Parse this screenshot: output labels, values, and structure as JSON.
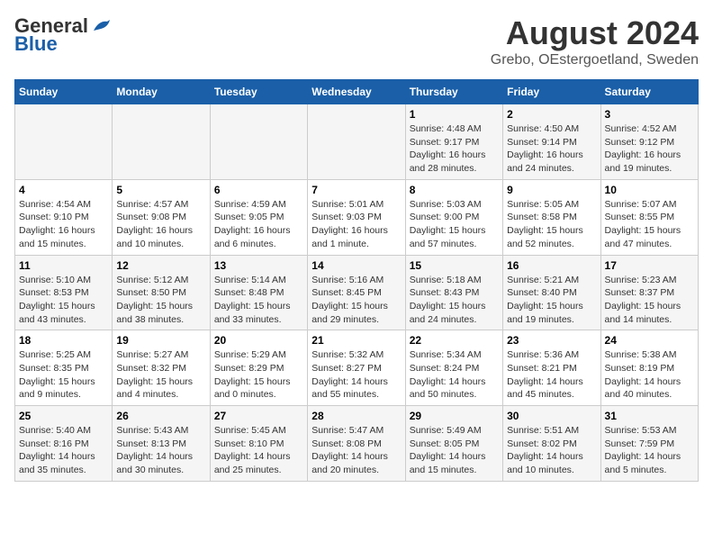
{
  "header": {
    "logo_general": "General",
    "logo_blue": "Blue",
    "main_title": "August 2024",
    "subtitle": "Grebo, OEstergoetland, Sweden"
  },
  "calendar": {
    "days_of_week": [
      "Sunday",
      "Monday",
      "Tuesday",
      "Wednesday",
      "Thursday",
      "Friday",
      "Saturday"
    ],
    "weeks": [
      [
        {
          "day": "",
          "info": ""
        },
        {
          "day": "",
          "info": ""
        },
        {
          "day": "",
          "info": ""
        },
        {
          "day": "",
          "info": ""
        },
        {
          "day": "1",
          "info": "Sunrise: 4:48 AM\nSunset: 9:17 PM\nDaylight: 16 hours\nand 28 minutes."
        },
        {
          "day": "2",
          "info": "Sunrise: 4:50 AM\nSunset: 9:14 PM\nDaylight: 16 hours\nand 24 minutes."
        },
        {
          "day": "3",
          "info": "Sunrise: 4:52 AM\nSunset: 9:12 PM\nDaylight: 16 hours\nand 19 minutes."
        }
      ],
      [
        {
          "day": "4",
          "info": "Sunrise: 4:54 AM\nSunset: 9:10 PM\nDaylight: 16 hours\nand 15 minutes."
        },
        {
          "day": "5",
          "info": "Sunrise: 4:57 AM\nSunset: 9:08 PM\nDaylight: 16 hours\nand 10 minutes."
        },
        {
          "day": "6",
          "info": "Sunrise: 4:59 AM\nSunset: 9:05 PM\nDaylight: 16 hours\nand 6 minutes."
        },
        {
          "day": "7",
          "info": "Sunrise: 5:01 AM\nSunset: 9:03 PM\nDaylight: 16 hours\nand 1 minute."
        },
        {
          "day": "8",
          "info": "Sunrise: 5:03 AM\nSunset: 9:00 PM\nDaylight: 15 hours\nand 57 minutes."
        },
        {
          "day": "9",
          "info": "Sunrise: 5:05 AM\nSunset: 8:58 PM\nDaylight: 15 hours\nand 52 minutes."
        },
        {
          "day": "10",
          "info": "Sunrise: 5:07 AM\nSunset: 8:55 PM\nDaylight: 15 hours\nand 47 minutes."
        }
      ],
      [
        {
          "day": "11",
          "info": "Sunrise: 5:10 AM\nSunset: 8:53 PM\nDaylight: 15 hours\nand 43 minutes."
        },
        {
          "day": "12",
          "info": "Sunrise: 5:12 AM\nSunset: 8:50 PM\nDaylight: 15 hours\nand 38 minutes."
        },
        {
          "day": "13",
          "info": "Sunrise: 5:14 AM\nSunset: 8:48 PM\nDaylight: 15 hours\nand 33 minutes."
        },
        {
          "day": "14",
          "info": "Sunrise: 5:16 AM\nSunset: 8:45 PM\nDaylight: 15 hours\nand 29 minutes."
        },
        {
          "day": "15",
          "info": "Sunrise: 5:18 AM\nSunset: 8:43 PM\nDaylight: 15 hours\nand 24 minutes."
        },
        {
          "day": "16",
          "info": "Sunrise: 5:21 AM\nSunset: 8:40 PM\nDaylight: 15 hours\nand 19 minutes."
        },
        {
          "day": "17",
          "info": "Sunrise: 5:23 AM\nSunset: 8:37 PM\nDaylight: 15 hours\nand 14 minutes."
        }
      ],
      [
        {
          "day": "18",
          "info": "Sunrise: 5:25 AM\nSunset: 8:35 PM\nDaylight: 15 hours\nand 9 minutes."
        },
        {
          "day": "19",
          "info": "Sunrise: 5:27 AM\nSunset: 8:32 PM\nDaylight: 15 hours\nand 4 minutes."
        },
        {
          "day": "20",
          "info": "Sunrise: 5:29 AM\nSunset: 8:29 PM\nDaylight: 15 hours\nand 0 minutes."
        },
        {
          "day": "21",
          "info": "Sunrise: 5:32 AM\nSunset: 8:27 PM\nDaylight: 14 hours\nand 55 minutes."
        },
        {
          "day": "22",
          "info": "Sunrise: 5:34 AM\nSunset: 8:24 PM\nDaylight: 14 hours\nand 50 minutes."
        },
        {
          "day": "23",
          "info": "Sunrise: 5:36 AM\nSunset: 8:21 PM\nDaylight: 14 hours\nand 45 minutes."
        },
        {
          "day": "24",
          "info": "Sunrise: 5:38 AM\nSunset: 8:19 PM\nDaylight: 14 hours\nand 40 minutes."
        }
      ],
      [
        {
          "day": "25",
          "info": "Sunrise: 5:40 AM\nSunset: 8:16 PM\nDaylight: 14 hours\nand 35 minutes."
        },
        {
          "day": "26",
          "info": "Sunrise: 5:43 AM\nSunset: 8:13 PM\nDaylight: 14 hours\nand 30 minutes."
        },
        {
          "day": "27",
          "info": "Sunrise: 5:45 AM\nSunset: 8:10 PM\nDaylight: 14 hours\nand 25 minutes."
        },
        {
          "day": "28",
          "info": "Sunrise: 5:47 AM\nSunset: 8:08 PM\nDaylight: 14 hours\nand 20 minutes."
        },
        {
          "day": "29",
          "info": "Sunrise: 5:49 AM\nSunset: 8:05 PM\nDaylight: 14 hours\nand 15 minutes."
        },
        {
          "day": "30",
          "info": "Sunrise: 5:51 AM\nSunset: 8:02 PM\nDaylight: 14 hours\nand 10 minutes."
        },
        {
          "day": "31",
          "info": "Sunrise: 5:53 AM\nSunset: 7:59 PM\nDaylight: 14 hours\nand 5 minutes."
        }
      ]
    ]
  }
}
